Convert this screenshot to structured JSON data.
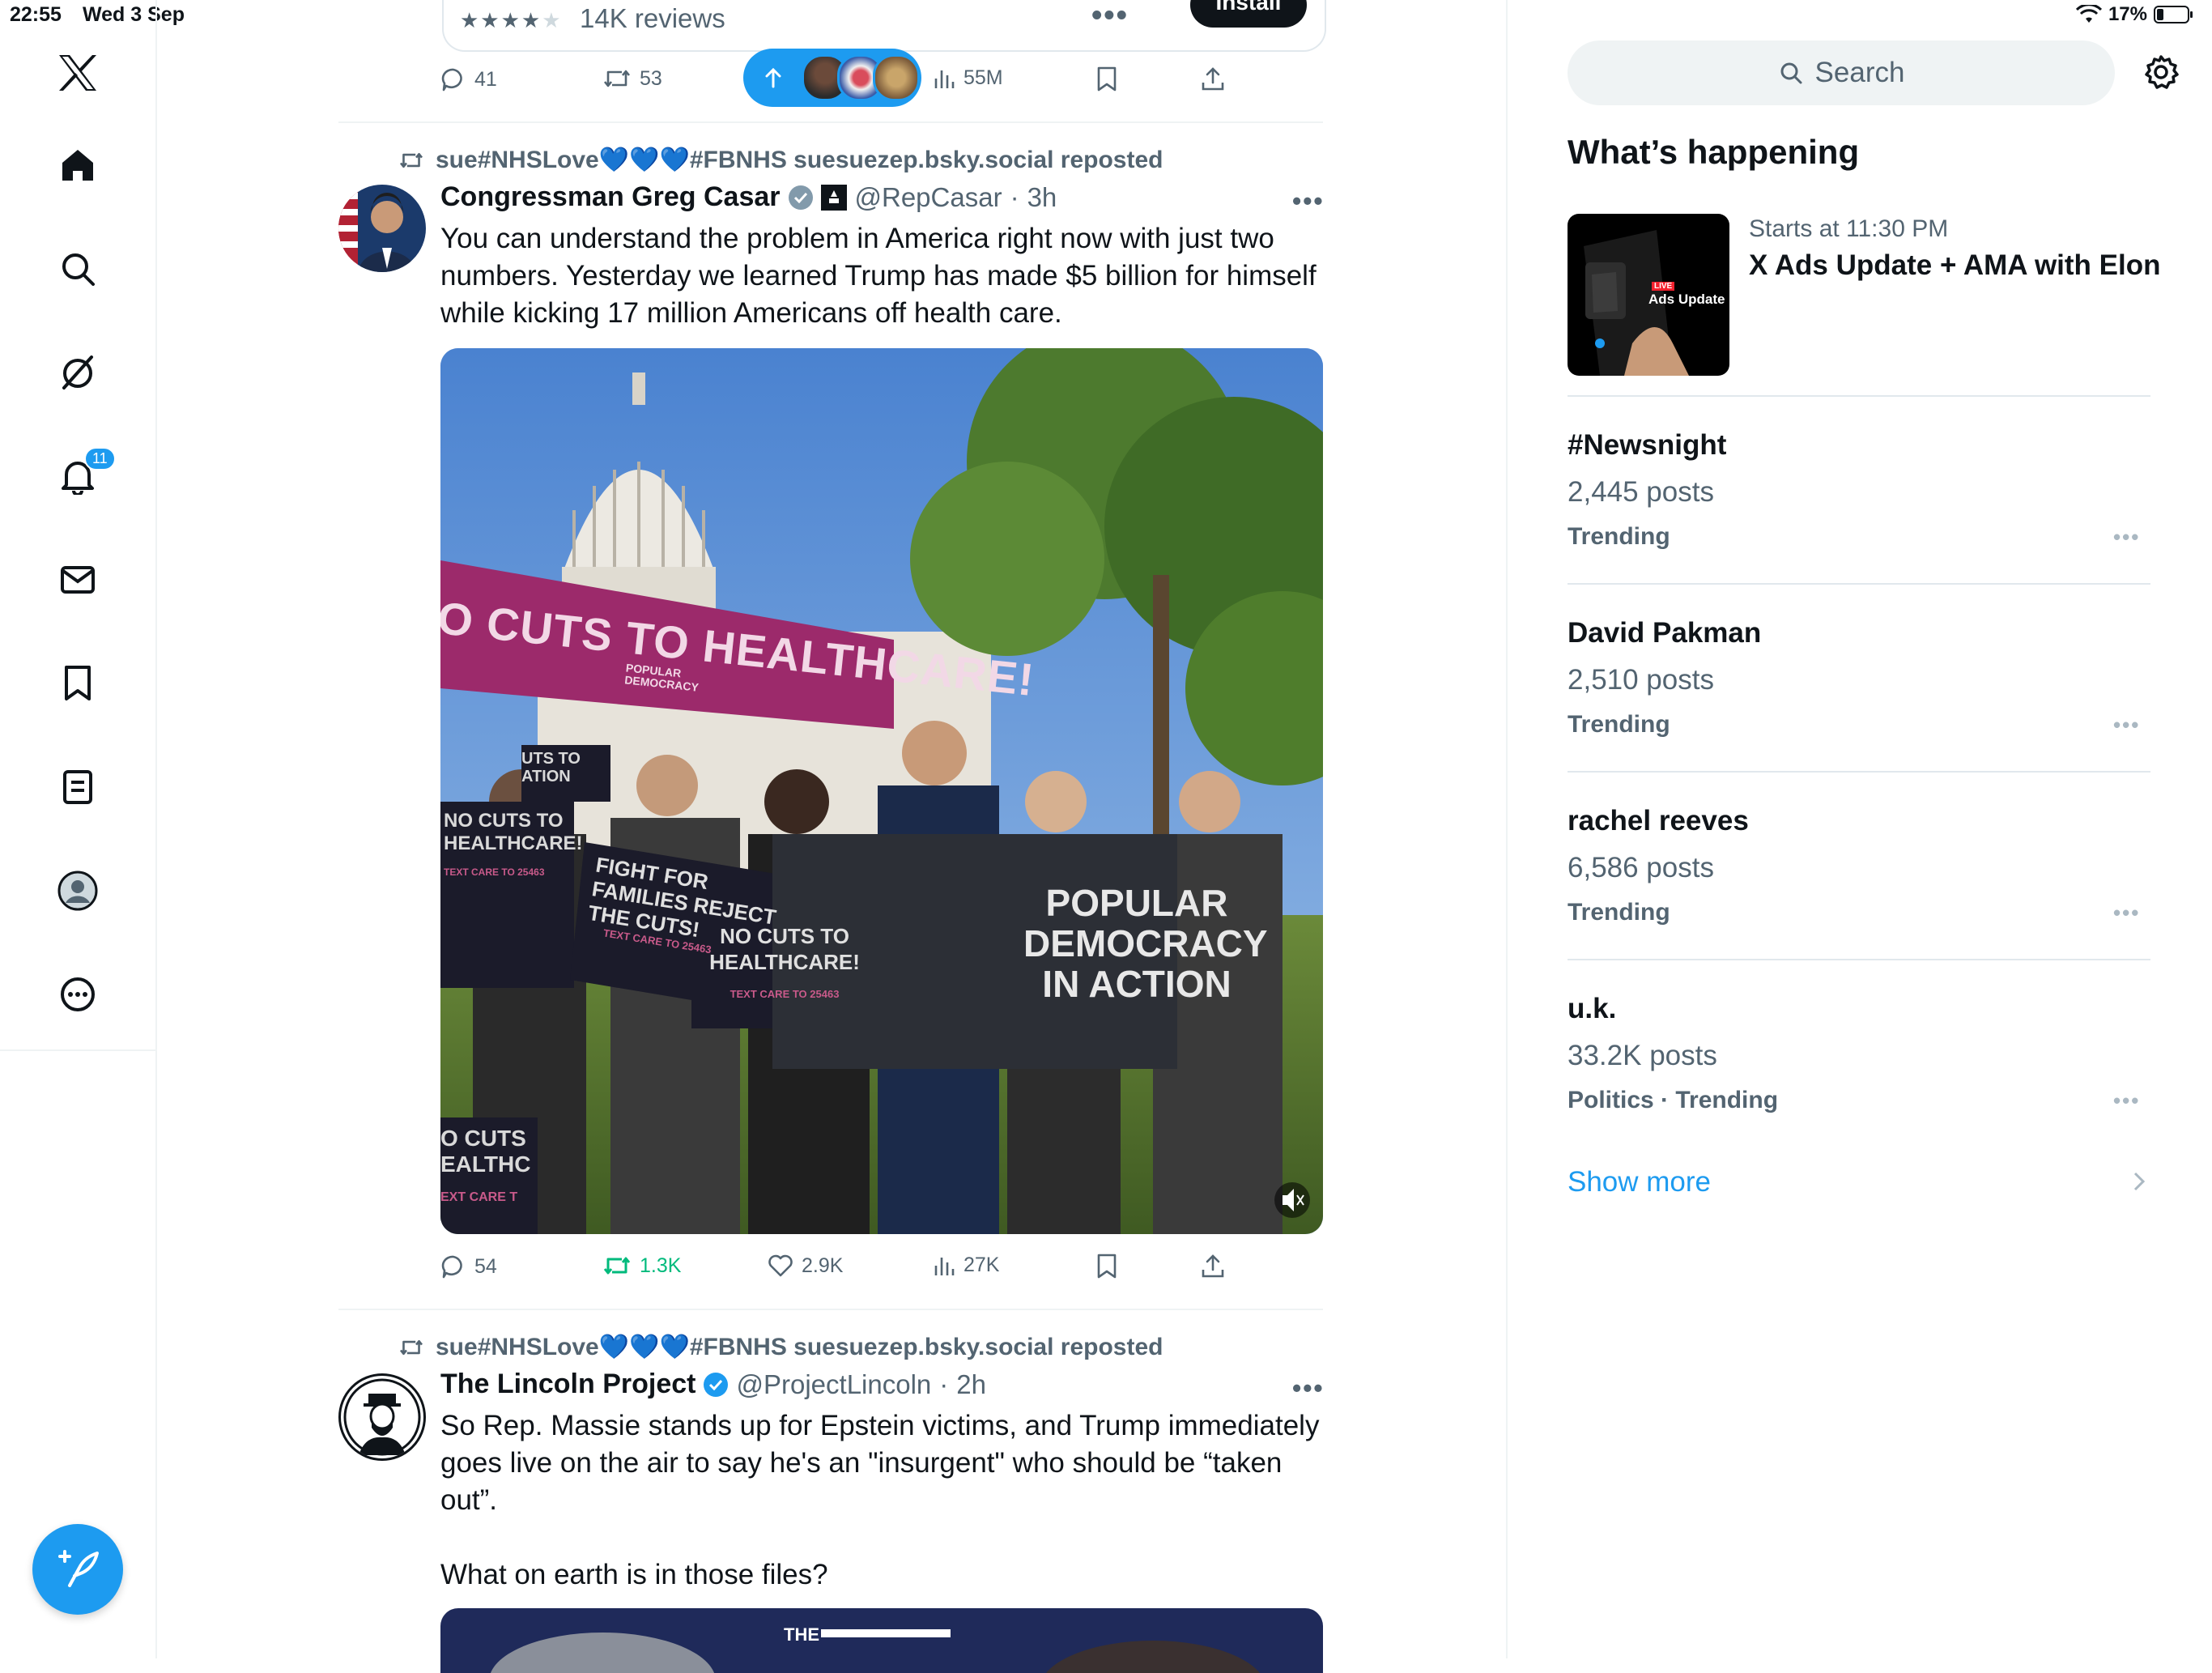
{
  "status": {
    "time": "22:55",
    "date": "Wed 3 Sep",
    "battery": "17%"
  },
  "nav": {
    "items": [
      "x-logo",
      "home",
      "explore",
      "grok",
      "notifications",
      "messages",
      "bookmarks",
      "lists",
      "profile",
      "more"
    ],
    "notifications_badge": "11"
  },
  "ad": {
    "reviews": "14K reviews",
    "install": "Install",
    "rating_stars": 4
  },
  "ad_actions": {
    "replies": "41",
    "reposts": "53",
    "views": "55M"
  },
  "posts": [
    {
      "reposted_by": "sue#NHSLove",
      "reposted_by_rest": "#FBNHS suesuezep.bsky.social reposted",
      "author": "Congressman Greg Casar",
      "handle": "@RepCasar",
      "time": "3h",
      "text": "You can understand the problem in America right now with just two numbers. Yesterday we learned Trump has made $5 billion for himself while kicking 17 million Americans off health care.",
      "media": {
        "banner": "O CUTS TO HEALTHCARE!",
        "banner_small": "POPULAR DEMOCRACY",
        "sign_left1": "NO CUTS TO HEALTHCARE!",
        "sign_left1_sub": "TEXT CARE TO 25463",
        "sign_mid": "FIGHT FOR FAMILIES REJECT THE CUTS!",
        "sign_mid_sub": "TEXT CARE TO 25463",
        "sign_center": "NO CUTS TO HEALTHCARE!",
        "sign_center_sub": "TEXT CARE TO 25463",
        "sign_right": "POPULAR DEMOCRACY IN ACTION",
        "sign_small_left": "UTS TO ATION",
        "sign_bottom_left": "O CUTS EALTHC",
        "sign_bottom_left_sub": "EXT CARE T"
      },
      "replies": "54",
      "reposts": "1.3K",
      "likes": "2.9K",
      "views": "27K"
    },
    {
      "reposted_by": "sue#NHSLove",
      "reposted_by_rest": "#FBNHS suesuezep.bsky.social reposted",
      "author": "The Lincoln Project",
      "handle": "@ProjectLincoln",
      "time": "2h",
      "text": "So Rep. Massie stands up for Epstein victims, and Trump immediately goes live on the air to say he's an \"insurgent\" who should be “taken out”.",
      "text2": "What on earth is in those files?",
      "media_label": "THE"
    }
  ],
  "sidebar": {
    "search_placeholder": "Search",
    "title": "What’s happening",
    "event": {
      "time": "Starts at 11:30 PM",
      "title": "X Ads Update + AMA with Elon",
      "thumb_text": "Ads Update",
      "thumb_live": "LIVE"
    },
    "trends": [
      {
        "name": "#Newsnight",
        "count": "2,445 posts",
        "tag": "Trending"
      },
      {
        "name": "David Pakman",
        "count": "2,510 posts",
        "tag": "Trending"
      },
      {
        "name": "rachel reeves",
        "count": "6,586 posts",
        "tag": "Trending"
      },
      {
        "name": "u.k.",
        "count": "33.2K posts",
        "tag": "Politics · Trending"
      }
    ],
    "show_more": "Show more"
  },
  "colors": {
    "accent": "#1d9bf0",
    "text": "#0f1419",
    "muted": "#536471",
    "repost_active": "#00ba7c",
    "banner": "#9c2a6b"
  }
}
